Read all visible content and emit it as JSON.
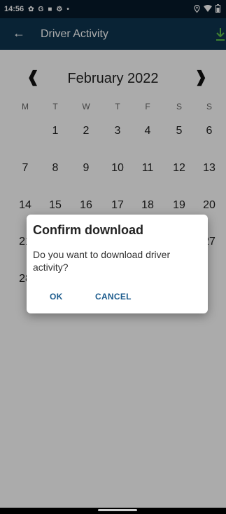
{
  "status_bar": {
    "time": "14:56",
    "icons": [
      "settings-icon",
      "google-icon",
      "square-icon",
      "gear-icon",
      "dot-icon"
    ],
    "right_icons": [
      "location-icon",
      "wifi-icon",
      "battery-icon"
    ]
  },
  "app_bar": {
    "title": "Driver Activity",
    "back_icon": "back-arrow-icon",
    "action_icon": "download-icon"
  },
  "calendar": {
    "month": "February 2022",
    "weekdays": [
      "M",
      "T",
      "W",
      "T",
      "F",
      "S",
      "S"
    ],
    "weeks": [
      [
        "",
        "1",
        "2",
        "3",
        "4",
        "5",
        "6"
      ],
      [
        "7",
        "8",
        "9",
        "10",
        "11",
        "12",
        "13"
      ],
      [
        "14",
        "15",
        "16",
        "17",
        "18",
        "19",
        "20"
      ],
      [
        "21",
        "",
        "",
        "",
        "",
        "",
        "27"
      ],
      [
        "28",
        "",
        "",
        "",
        "",
        "",
        ""
      ]
    ]
  },
  "dialog": {
    "title": "Confirm download",
    "message": "Do you want to download driver activity?",
    "ok": "OK",
    "cancel": "CANCEL"
  },
  "colors": {
    "status_bar": "#071a2a",
    "app_bar": "#0e3550",
    "accent": "#1a5a8c",
    "download_icon": "#5fc04a"
  }
}
